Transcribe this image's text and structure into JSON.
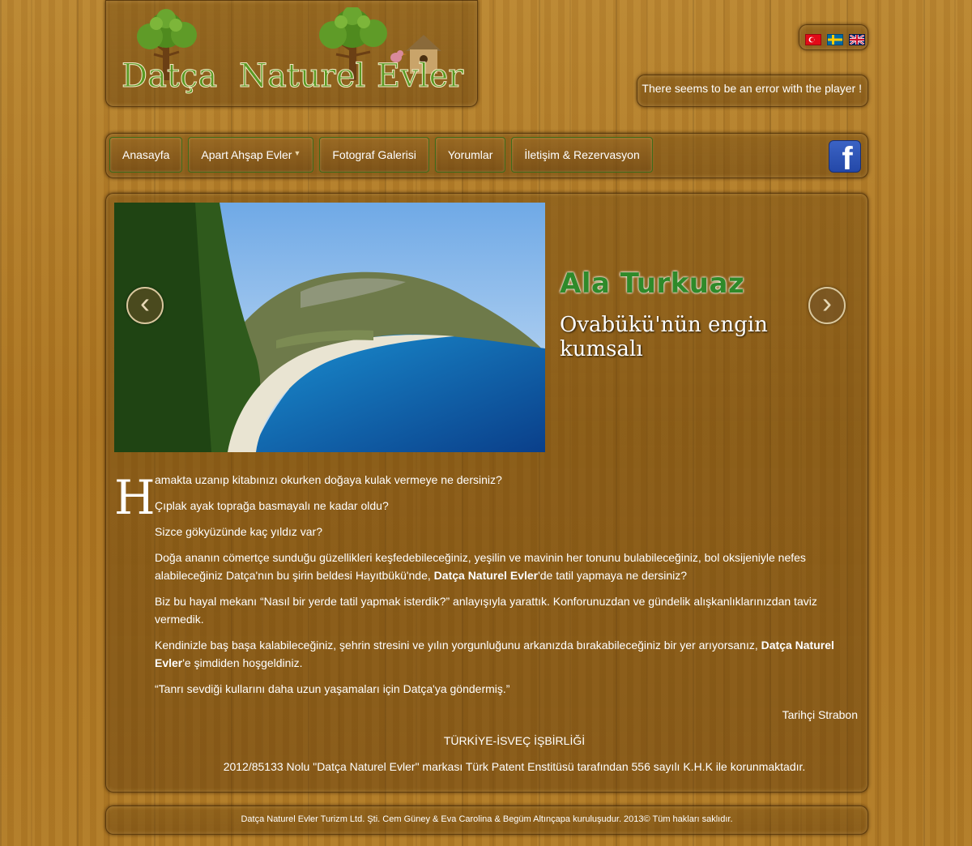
{
  "logo": {
    "text": "Datça Naturel Evler"
  },
  "languages": [
    {
      "name": "Türkçe",
      "icon": "turkey-flag-icon"
    },
    {
      "name": "Svenska",
      "icon": "sweden-flag-icon"
    },
    {
      "name": "English",
      "icon": "uk-flag-icon"
    }
  ],
  "player": {
    "error_text": "There seems to be an error with the player !"
  },
  "nav": {
    "items": [
      {
        "label": "Anasayfa"
      },
      {
        "label": "Apart Ahşap Evler",
        "has_dropdown": true
      },
      {
        "label": "Fotograf Galerisi"
      },
      {
        "label": "Yorumlar"
      },
      {
        "label": "İletişim & Rezervasyon"
      }
    ],
    "facebook_icon": "facebook-icon"
  },
  "slider": {
    "title": "Ala Turkuaz",
    "subtitle": "Ovabükü'nün engin kumsalı",
    "prev_icon": "chevron-left-icon",
    "next_icon": "chevron-right-icon"
  },
  "content": {
    "dropcap": "H",
    "p1": "amakta uzanıp kitabınızı okurken doğaya kulak vermeye ne dersiniz?",
    "p2": "Çıplak ayak toprağa basmayalı ne kadar oldu?",
    "p3": "Sizce gökyüzünde kaç yıldız var?",
    "p4_a": "Doğa ananın cömertçe sunduğu güzellikleri keşfedebileceğiniz, yeşilin ve mavinin her tonunu bulabileceğiniz, bol oksijeniyle nefes alabileceğiniz Datça'nın bu şirin beldesi Hayıtbükü'nde, ",
    "p4_b": "Datça Naturel Evler",
    "p4_c": "'de tatil yapmaya ne dersiniz?",
    "p5": "Biz bu hayal mekanı “Nasıl bir yerde tatil yapmak isterdik?” anlayışıyla yarattık. Konforunuzdan ve gündelik alışkanlıklarınızdan taviz vermedik.",
    "p6_a": "Kendinizle baş başa kalabileceğiniz, şehrin stresini ve yılın yorgunluğunu arkanızda bırakabileceğiniz bir yer arıyorsanız, ",
    "p6_b": "Datça Naturel Evler",
    "p6_c": "'e şimdiden hoşgeldiniz.",
    "quote": "“Tanrı sevdiği kullarını daha uzun yaşamaları için Datça'ya göndermiş.”",
    "quote_author": "Tarihçi Strabon",
    "cooperation": "TÜRKİYE-İSVEÇ İŞBİRLİĞİ",
    "patent": "2012/85133 Nolu \"Datça Naturel Evler\" markası Türk Patent Enstitüsü tarafından 556 sayılı K.H.K ile korunmaktadır."
  },
  "footer": {
    "text": "Datça Naturel Evler Turizm Ltd. Şti. Cem Güney & Eva Carolina & Begüm Altınçapa kuruluşudur. 2013© Tüm hakları saklıdır."
  }
}
